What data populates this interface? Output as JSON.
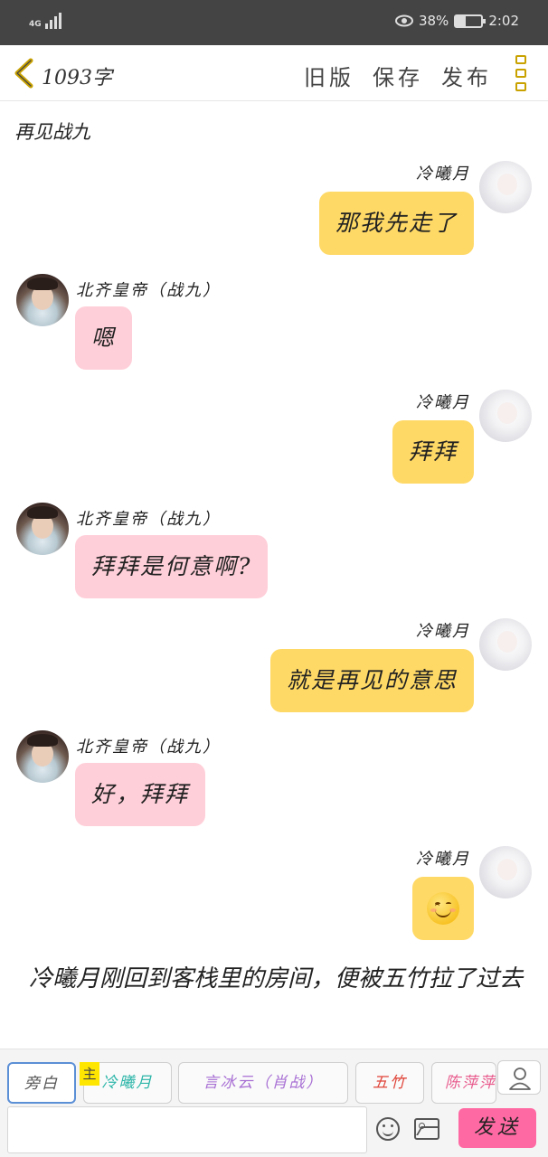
{
  "status_bar": {
    "network": "4G",
    "battery_percent": "38%",
    "battery_level": 0.38,
    "time": "2:02",
    "icons": [
      "signal-icon",
      "eye-icon",
      "battery-icon"
    ]
  },
  "top_bar": {
    "word_count": "1093字",
    "actions": [
      "旧版",
      "保存",
      "发布"
    ],
    "icons": [
      "back-chevron-icon",
      "menu-icon"
    ]
  },
  "story": {
    "intro_narration": "再见战九",
    "messages": [
      {
        "speaker": "冷曦月",
        "side": "right",
        "text": "那我先走了"
      },
      {
        "speaker": "北齐皇帝（战九）",
        "side": "left",
        "text": "嗯"
      },
      {
        "speaker": "冷曦月",
        "side": "right",
        "text": "拜拜"
      },
      {
        "speaker": "北齐皇帝（战九）",
        "side": "left",
        "text": "拜拜是何意啊?"
      },
      {
        "speaker": "冷曦月",
        "side": "right",
        "text": "就是再见的意思"
      },
      {
        "speaker": "北齐皇帝（战九）",
        "side": "left",
        "text": "好，拜拜"
      },
      {
        "speaker": "冷曦月",
        "side": "right",
        "text": "",
        "emoji": "smiling-face-emoji"
      }
    ],
    "closing_narration": "冷曦月刚回到客栈里的房间，便被五竹拉了过去"
  },
  "character_bar": {
    "chips": [
      "旁白",
      "冷曦月",
      "言冰云（肖战）",
      "五竹",
      "陈萍萍"
    ],
    "main_tag": "主",
    "selected": "旁白"
  },
  "input_bar": {
    "value": "",
    "send_label": "发送",
    "icons": [
      "emoji-icon",
      "image-icon"
    ]
  },
  "colors": {
    "status_bar": "#444444",
    "self_bubble": "#ffd966",
    "other_bubble": "#ffcfd9",
    "send_button": "#ff69a3",
    "accent_icon": "#c9a200",
    "main_tag": "#ffe600"
  }
}
